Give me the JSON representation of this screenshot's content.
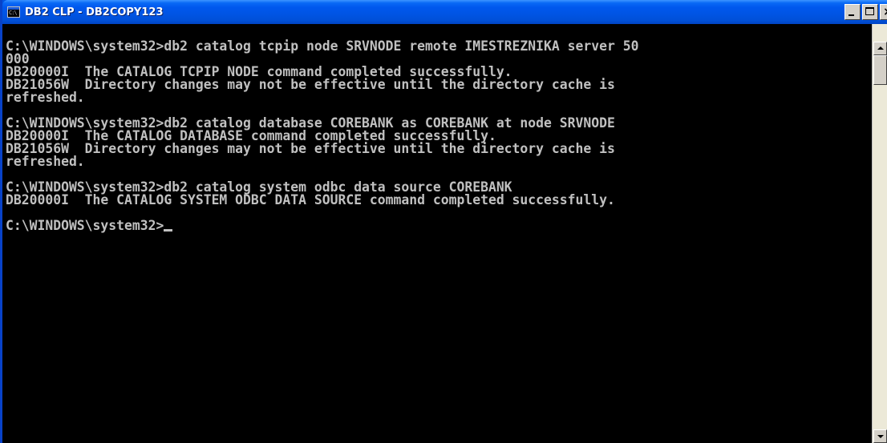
{
  "window": {
    "title": "DB2 CLP - DB2COPY123",
    "icon": "console-icon",
    "icon_text": "C:\\",
    "buttons": {
      "minimize": "minimize-icon",
      "maximize": "maximize-icon",
      "close": "close-icon",
      "close_glyph": "×"
    }
  },
  "console": {
    "lines": [
      "C:\\WINDOWS\\system32>db2 catalog tcpip node SRVNODE remote IMESTREZNIKA server 50",
      "000",
      "DB20000I  The CATALOG TCPIP NODE command completed successfully.",
      "DB21056W  Directory changes may not be effective until the directory cache is",
      "refreshed.",
      "",
      "C:\\WINDOWS\\system32>db2 catalog database COREBANK as COREBANK at node SRVNODE",
      "DB20000I  The CATALOG DATABASE command completed successfully.",
      "DB21056W  Directory changes may not be effective until the directory cache is",
      "refreshed.",
      "",
      "C:\\WINDOWS\\system32>db2 catalog system odbc data source COREBANK",
      "DB20000I  The CATALOG SYSTEM ODBC DATA SOURCE command completed successfully.",
      ""
    ],
    "prompt": "C:\\WINDOWS\\system32>"
  },
  "colors": {
    "title_bar": "#0054e3",
    "console_bg": "#000000",
    "console_text": "#c0c0c0"
  }
}
